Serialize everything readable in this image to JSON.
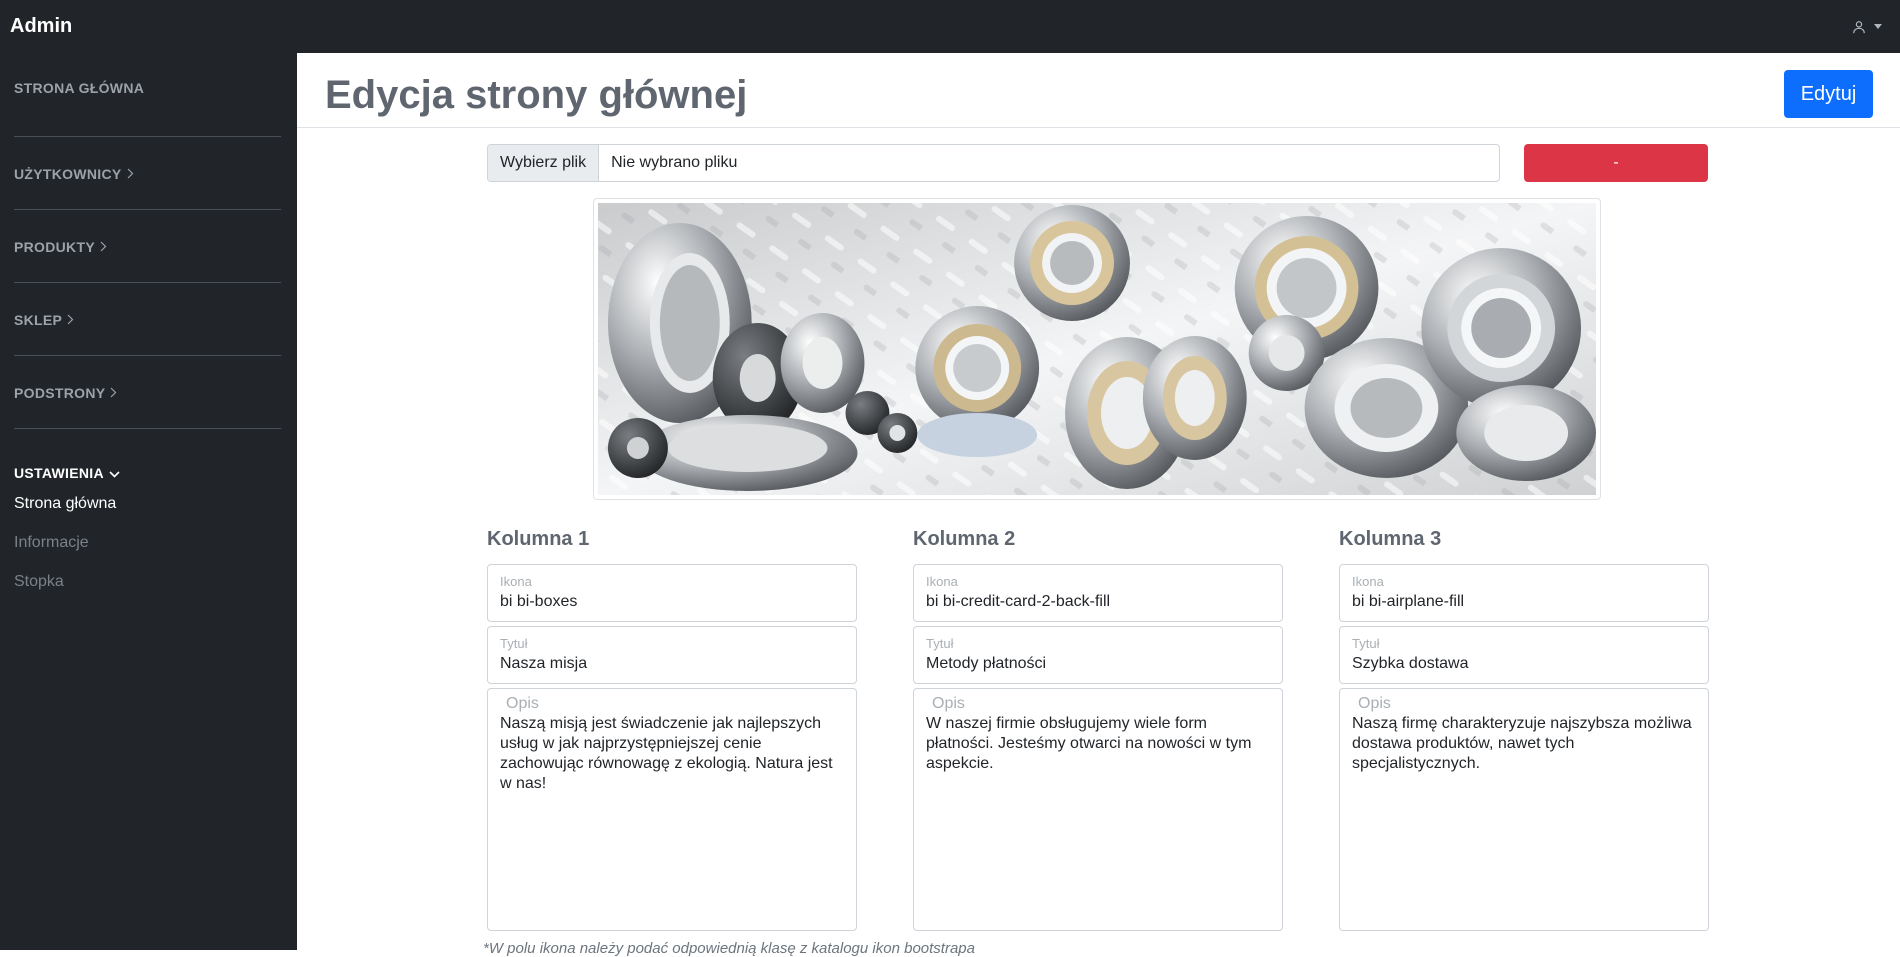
{
  "app": {
    "brand": "Admin",
    "user_icon": "person-icon"
  },
  "sidebar": {
    "sections": [
      {
        "label": "STRONA GŁÓWNA"
      },
      {
        "label": "UŻYTKOWNICY"
      },
      {
        "label": "PRODUKTY"
      },
      {
        "label": "SKLEP"
      },
      {
        "label": "PODSTRONY"
      },
      {
        "label": "USTAWIENIA",
        "items": [
          "Strona główna",
          "Informacje",
          "Stopka"
        ]
      }
    ]
  },
  "page": {
    "title": "Edycja strony głównej",
    "edit_button": "Edytuj",
    "file": {
      "button": "Wybierz plik",
      "status": "Nie wybrano pliku"
    },
    "remove_button": "-"
  },
  "columns": [
    {
      "heading": "Kolumna 1",
      "icon_label": "Ikona",
      "icon": "bi bi-boxes",
      "title_label": "Tytuł",
      "title": "Nasza misja",
      "desc_label": "Opis",
      "desc": "Naszą misją jest świadczenie jak najlepszych usług w jak najprzystępniejszej cenie zachowując równowagę z ekologią. Natura jest w nas!"
    },
    {
      "heading": "Kolumna 2",
      "icon_label": "Ikona",
      "icon": "bi bi-credit-card-2-back-fill",
      "title_label": "Tytuł",
      "title": "Metody płatności",
      "desc_label": "Opis",
      "desc": "W naszej firmie obsługujemy wiele form płatności. Jesteśmy otwarci na nowości w tym aspekcie."
    },
    {
      "heading": "Kolumna 3",
      "icon_label": "Ikona",
      "icon": "bi bi-airplane-fill",
      "title_label": "Tytuł",
      "title": "Szybka dostawa",
      "desc_label": "Opis",
      "desc": "Naszą firmę charakteryzuje najszybsza możliwa dostawa produktów, nawet tych specjalistycznych."
    }
  ],
  "footnote": "*W polu ikona należy podać odpowiednią klasę z katalogu ikon bootstrapa",
  "colors": {
    "primary": "#0d6efd",
    "danger": "#dc3545",
    "dark": "#212529"
  }
}
